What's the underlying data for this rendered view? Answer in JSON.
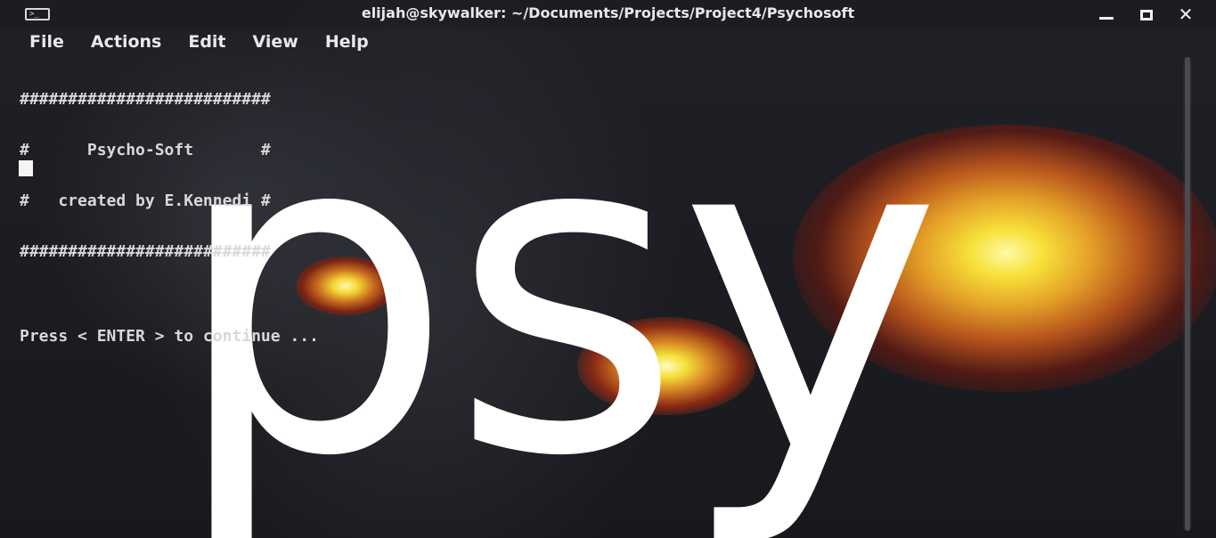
{
  "window": {
    "title": "elijah@skywalker: ~/Documents/Projects/Project4/Psychosoft",
    "app_icon": "terminal-icon",
    "icon_glyph": ">_",
    "controls": {
      "minimize_icon": "minimize-icon",
      "maximize_icon": "maximize-icon",
      "close_icon": "close-icon",
      "close_glyph": "✕"
    }
  },
  "menu": {
    "items": [
      "File",
      "Actions",
      "Edit",
      "View",
      "Help"
    ]
  },
  "terminal": {
    "lines": [
      "##########################",
      "#      Psycho-Soft       #",
      "#   created by E.Kennedi #",
      "##########################",
      "",
      "Press < ENTER > to continue ..."
    ]
  },
  "wallpaper": {
    "text": "psy",
    "text_color": "#ffffff",
    "glow_colors": [
      "#fff9a8",
      "#f7e13a",
      "#e4a028",
      "#b4521c"
    ]
  },
  "colors": {
    "background": "#1c1d22",
    "text": "#d8d8d8",
    "cursor": "#f4f4f4"
  }
}
